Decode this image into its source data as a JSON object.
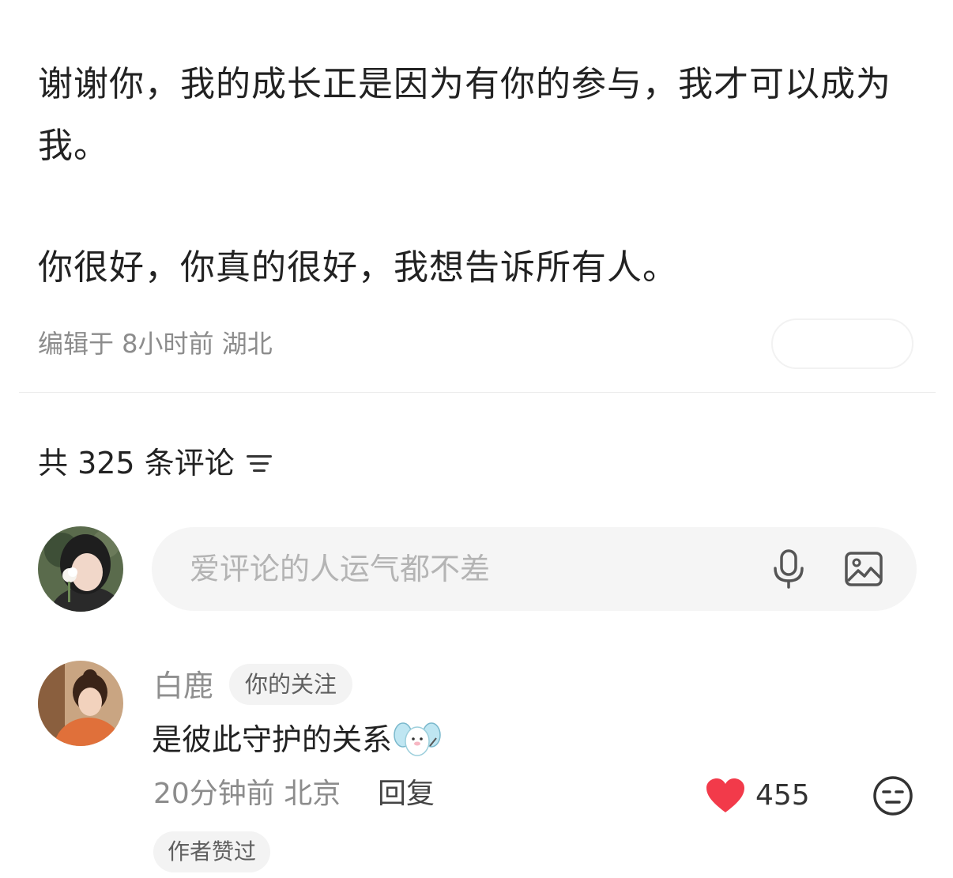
{
  "post": {
    "paragraph_1": "谢谢你，我的成长正是因为有你的参与，我才可以成为我。",
    "paragraph_2": "你很好，你真的很好，我想告诉所有人。",
    "meta": "编辑于 8小时前 湖北"
  },
  "comments_header": {
    "count_label": "共 325 条评论",
    "sort_icon": "sort-icon"
  },
  "comment_input": {
    "placeholder": "爱评论的人运气都不差",
    "voice_icon": "microphone-icon",
    "image_icon": "image-icon"
  },
  "reply": {
    "username": "白鹿",
    "follow_badge": "你的关注",
    "text": "是彼此守护的关系",
    "sticker_icon": "winged-sheep-sticker",
    "time_location": "20分钟前 北京",
    "reply_label": "回复",
    "like_count": "455",
    "liked": true,
    "author_badge": "作者赞过"
  },
  "colors": {
    "like_red": "#f23a4a",
    "text_primary": "#222222",
    "text_secondary": "#8c8c8c",
    "input_bg": "#f5f5f5"
  }
}
